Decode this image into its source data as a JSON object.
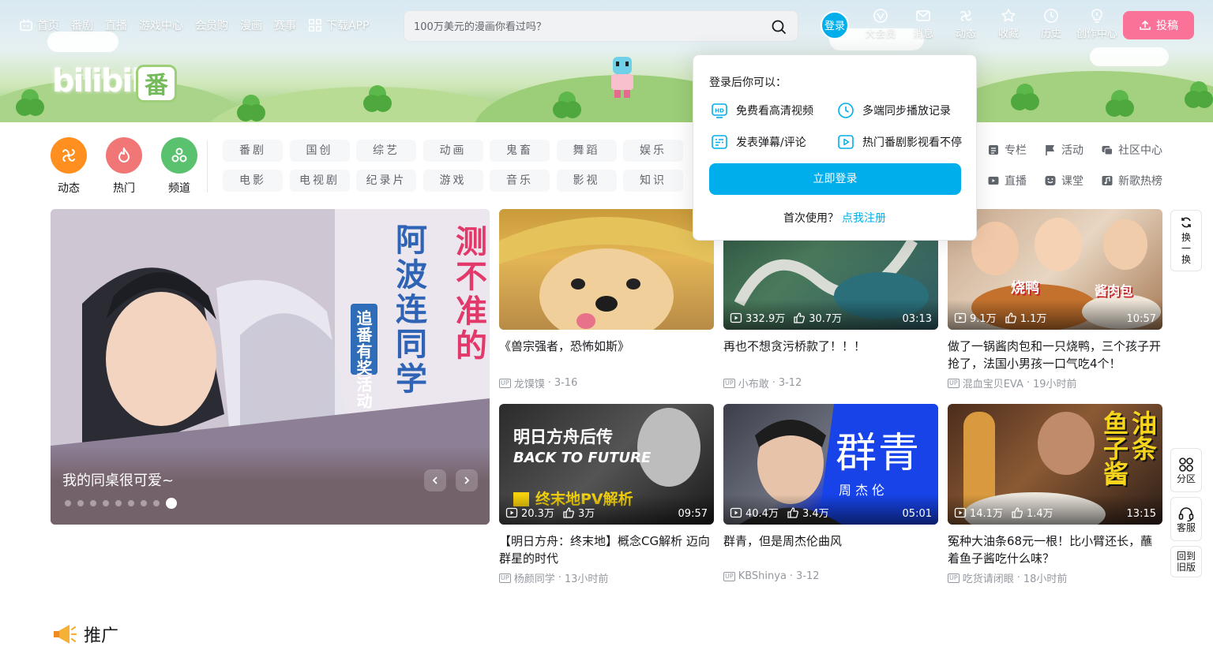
{
  "nav": {
    "left": [
      {
        "label": "首页",
        "icon": "tv-icon"
      },
      {
        "label": "番剧"
      },
      {
        "label": "直播"
      },
      {
        "label": "游戏中心"
      },
      {
        "label": "会员购"
      },
      {
        "label": "漫画"
      },
      {
        "label": "赛事"
      },
      {
        "label": "下载APP",
        "icon": "download-app-icon"
      }
    ],
    "search_placeholder": "100万美元的漫画你看过吗？",
    "login": "登录",
    "right": [
      {
        "label": "大会员",
        "icon": "vip-icon"
      },
      {
        "label": "消息",
        "icon": "message-icon"
      },
      {
        "label": "动态",
        "icon": "dynamic-icon"
      },
      {
        "label": "收藏",
        "icon": "star-icon"
      },
      {
        "label": "历史",
        "icon": "clock-icon"
      },
      {
        "label": "创作中心",
        "icon": "bulb-icon"
      }
    ],
    "upload": "投稿"
  },
  "banner": {
    "logo": "bilibili",
    "badge": "番"
  },
  "big_icons": [
    {
      "label": "动态",
      "color": "#ff8f1f"
    },
    {
      "label": "热门",
      "color": "#f07775"
    },
    {
      "label": "频道",
      "color": "#40c1ad"
    }
  ],
  "channels": [
    "番剧",
    "国创",
    "综艺",
    "动画",
    "鬼畜",
    "舞蹈",
    "娱乐",
    "电影",
    "电视剧",
    "纪录片",
    "游戏",
    "音乐",
    "影视",
    "知识"
  ],
  "channel_links": [
    {
      "label": "专栏",
      "icon": "column-icon"
    },
    {
      "label": "活动",
      "icon": "flag-icon"
    },
    {
      "label": "社区中心",
      "icon": "community-icon"
    },
    {
      "label": "直播",
      "icon": "live-icon"
    },
    {
      "label": "课堂",
      "icon": "classroom-icon"
    },
    {
      "label": "新歌热榜",
      "icon": "music-chart-icon"
    }
  ],
  "carousel": {
    "title": "我的同桌很可爱~",
    "art_text_a": "测不准的",
    "art_text_b": "阿波连同学",
    "art_text_c": "追番有奖活动",
    "dot_count": 9,
    "active_dot": 8
  },
  "videos": [
    {
      "title": "《兽宗强者，恐怖如斯》",
      "author": "龙馍馍",
      "date": "3-16",
      "views": "",
      "likes": "",
      "duration": ""
    },
    {
      "title": "再也不想贪污桥款了！！！",
      "author": "小布敢",
      "date": "3-12",
      "views": "332.9万",
      "likes": "30.7万",
      "duration": "03:13"
    },
    {
      "title": "做了一锅酱肉包和一只烧鸭，三个孩子开抢了，法国小男孩一口气吃4个！",
      "author": "混血宝贝EVA",
      "date": "19小时前",
      "views": "9.1万",
      "likes": "1.1万",
      "duration": "10:57",
      "art_a": "烧鸭",
      "art_b": "酱肉包"
    },
    {
      "title": "【明日方舟：终末地】概念CG解析 迈向群星的时代",
      "author": "杨颜同学",
      "date": "13小时前",
      "views": "20.3万",
      "likes": "3万",
      "duration": "09:57",
      "art_a": "明日方舟后传",
      "art_b": "BACK TO FUTURE",
      "art_c": "终末地PV解析"
    },
    {
      "title": "群青，但是周杰伦曲风",
      "author": "KBShinya",
      "date": "3-12",
      "views": "40.4万",
      "likes": "3.4万",
      "duration": "05:01",
      "art_a": "群青",
      "art_b": "周 杰 伦"
    },
    {
      "title": "冤种大油条68元一根！比小臂还长，蘸着鱼子酱吃什么味？",
      "author": "吃货请闭眼",
      "date": "18小时前",
      "views": "14.1万",
      "likes": "1.4万",
      "duration": "13:15",
      "art_a": "油条",
      "art_b": "鱼子酱"
    }
  ],
  "popup": {
    "title": "登录后你可以：",
    "features": [
      {
        "label": "免费看高清视频",
        "icon": "hd-icon"
      },
      {
        "label": "多端同步播放记录",
        "icon": "sync-clock-icon"
      },
      {
        "label": "发表弹幕/评论",
        "icon": "danmaku-icon"
      },
      {
        "label": "热门番剧影视看不停",
        "icon": "play-icon"
      }
    ],
    "login_button": "立即登录",
    "register_prompt": "首次使用？",
    "register_link": "点我注册"
  },
  "side": {
    "refresh": "换一换",
    "zone": "分区",
    "service": "客服",
    "old_version": "回到旧版"
  },
  "promo_title": "推广",
  "colors": {
    "accent": "#00aeec",
    "pink": "#fb7299"
  }
}
